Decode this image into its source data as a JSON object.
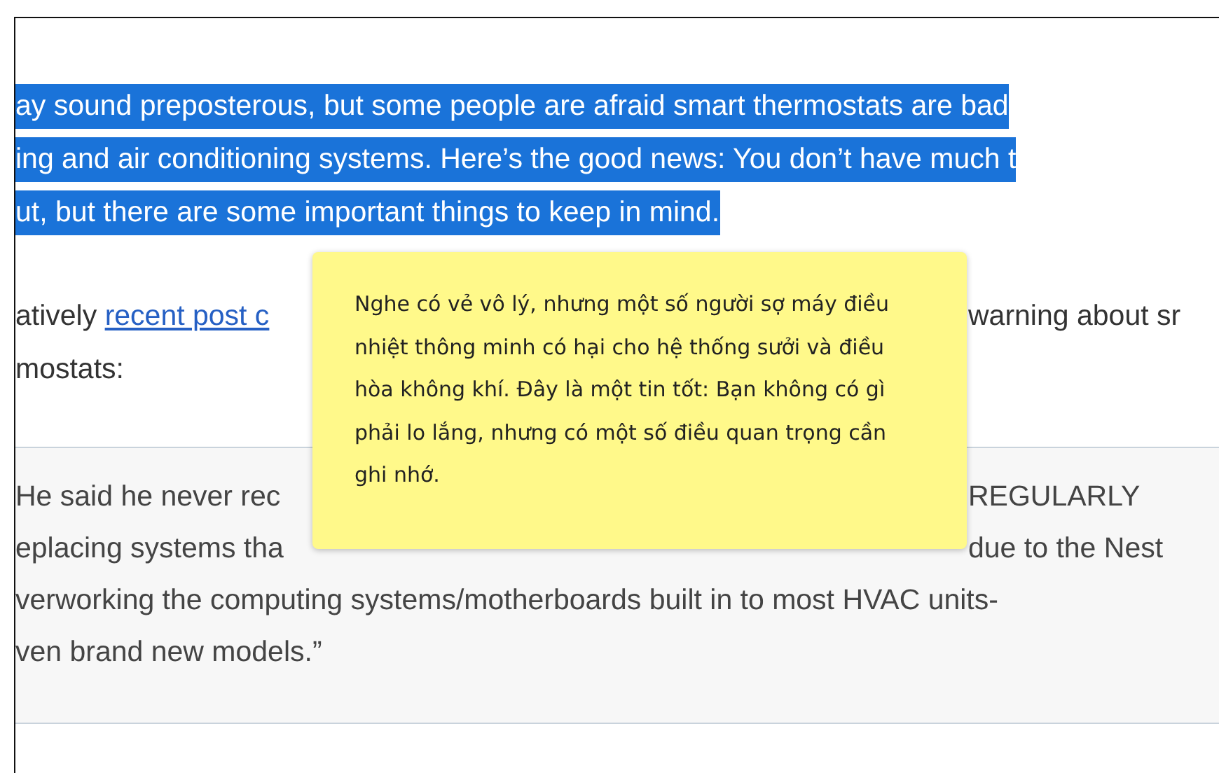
{
  "intro_paragraph": {
    "selected": true,
    "lines": [
      "ay sound preposterous, but some people are afraid smart thermostats are bad",
      "ing and air conditioning systems. Here’s the good news: You don’t have much t",
      "ut, but there are some important things to keep in mind."
    ]
  },
  "second_paragraph": {
    "lines": [
      {
        "left": "atively ",
        "link": "recent post c",
        "right": "warning about sr"
      },
      {
        "left": "mostats:"
      }
    ]
  },
  "blockquote": {
    "lines": [
      {
        "left": "He said he never rec",
        "right": "REGULARLY"
      },
      {
        "left": "eplacing systems tha",
        "right": "due to the Nest"
      },
      {
        "left": "verworking the computing systems/motherboards built in to most HVAC units-"
      },
      {
        "left": "ven brand new models.”"
      }
    ]
  },
  "translation_popup": {
    "text": "Nghe có vẻ vô lý, nhưng một số người sợ máy điều nhiệt thông minh có hại cho hệ thống sưởi và điều hòa không khí. Đây là một tin tốt: Bạn không có gì phải lo lắng, nhưng có một số điều quan trọng cần ghi nhớ."
  }
}
